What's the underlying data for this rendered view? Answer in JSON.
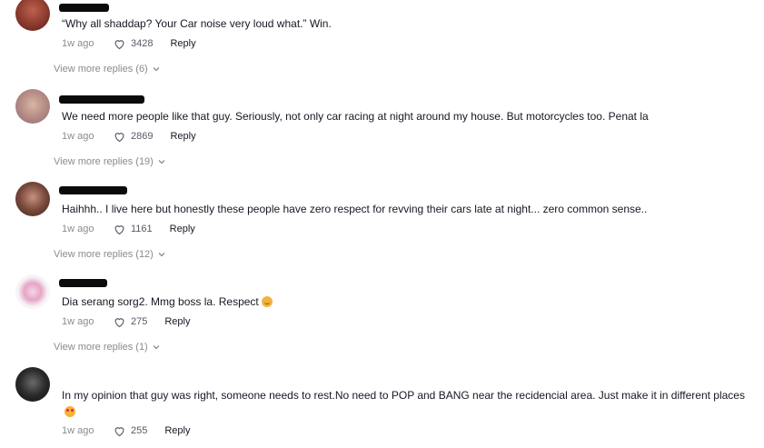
{
  "comments": [
    {
      "text": "“Why all shaddap? Your Car noise very loud what.” Win.",
      "time": "1w ago",
      "likes": "3428",
      "reply_label": "Reply",
      "view_more": "View more replies (6)",
      "emoji": ""
    },
    {
      "text": "We need more people like that guy. Seriously, not only car racing at night around my house. But motorcycles too. Penat la",
      "time": "1w ago",
      "likes": "2869",
      "reply_label": "Reply",
      "view_more": "View more replies (19)",
      "emoji": ""
    },
    {
      "text": "Haihhh.. I live here but honestly these people have zero respect for revving their cars late at night... zero common sense..",
      "time": "1w ago",
      "likes": "1161",
      "reply_label": "Reply",
      "view_more": "View more replies (12)",
      "emoji": ""
    },
    {
      "text": "Dia serang sorg2. Mmg boss la. Respect",
      "time": "1w ago",
      "likes": "275",
      "reply_label": "Reply",
      "view_more": "View more replies (1)",
      "emoji": "hugging-face-emoji"
    },
    {
      "text": "In my opinion that guy was right, someone needs to rest.No need to POP and BANG near the recidencial area. Just make it in different places",
      "time": "1w ago",
      "likes": "255",
      "reply_label": "Reply",
      "view_more": "",
      "emoji": "smiling-face-with-hearts-emoji"
    }
  ],
  "icons": {
    "like": "heart-outline-icon",
    "expand": "chevron-down-icon"
  },
  "colors": {
    "text_primary": "#161823",
    "text_secondary": "#8a8b91",
    "redaction": "#0b0b0b"
  }
}
